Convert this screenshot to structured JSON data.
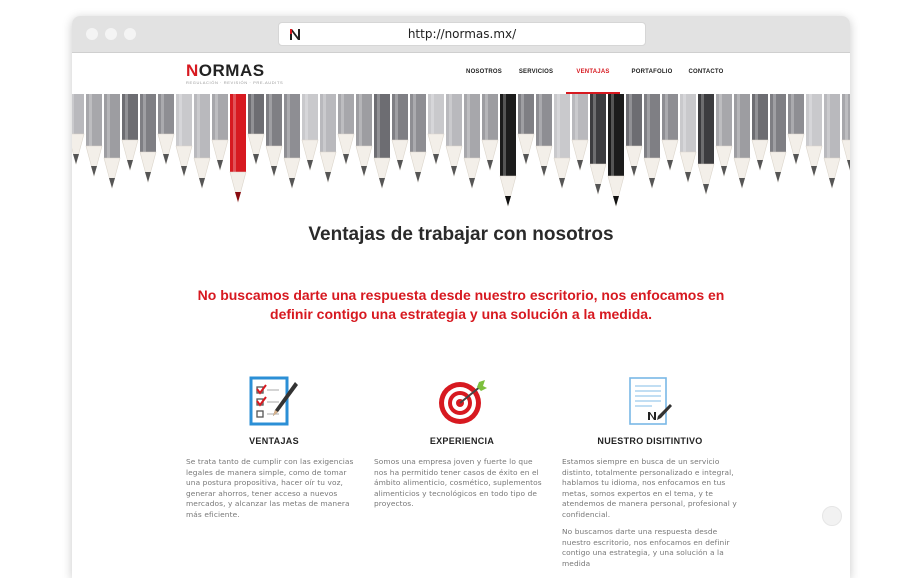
{
  "browser": {
    "url": "http://normas.mx/",
    "favicon_icon": "normas-n-icon"
  },
  "header": {
    "logo_initial": "N",
    "logo_rest": "ORMAS",
    "logo_tagline": "REGULACIÓN · REVISIÓN · PRE-AUDITS",
    "nav": [
      {
        "label": "NOSOTROS",
        "active": false
      },
      {
        "label": "SERVICIOS",
        "active": false
      },
      {
        "label": "VENTAJAS",
        "active": true
      },
      {
        "label": "PORTAFOLIO",
        "active": false
      },
      {
        "label": "CONTACTO",
        "active": false
      }
    ],
    "accent": "#d71920"
  },
  "hero": {
    "image_icon": "pencils-banner",
    "title": "Ventajas de trabajar con nosotros"
  },
  "tagline": {
    "line1": "No buscamos darte una respuesta desde nuestro escritorio, nos enfocamos en",
    "line2": "definir contigo una estrategia y una solución a la medida."
  },
  "features": [
    {
      "icon": "checklist-icon",
      "title": "VENTAJAS",
      "paragraphs": [
        "Se trata tanto de cumplir con las exigencias legales de manera simple, como de tomar una postura propositiva, hacer oír tu voz, generar ahorros, tener acceso a nuevos mercados, y alcanzar las metas de manera más eficiente."
      ]
    },
    {
      "icon": "target-icon",
      "title": "EXPERIENCIA",
      "paragraphs": [
        "Somos una empresa joven y fuerte lo que nos ha permitido tener casos de éxito en el ámbito alimenticio, cosmético, suplementos alimenticios y tecnológicos en todo tipo de proyectos."
      ]
    },
    {
      "icon": "document-signed-icon",
      "title": "NUESTRO DISITINTIVO",
      "paragraphs": [
        "Estamos siempre en busca de un servicio distinto, totalmente personalizado e integral, hablamos tu idioma, nos enfocamos en tus metas, somos expertos en el tema, y te atendemos de manera personal, profesional y confidencial.",
        "No buscamos darte una respuesta desde nuestro escritorio, nos enfocamos en definir contigo una estrategia, y una solución a la medida"
      ]
    }
  ],
  "scroll_top_icon": "chevron-up-icon"
}
